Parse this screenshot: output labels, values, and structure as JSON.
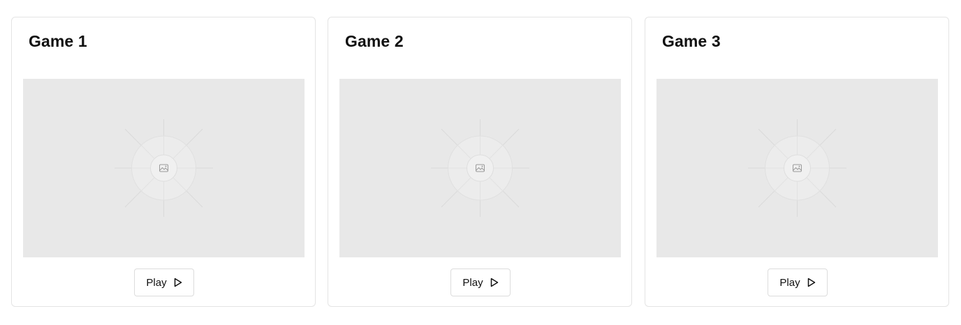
{
  "games": [
    {
      "title": "Game 1",
      "play_label": "Play",
      "image_icon": "image-icon",
      "play_icon": "play-icon"
    },
    {
      "title": "Game 2",
      "play_label": "Play",
      "image_icon": "image-icon",
      "play_icon": "play-icon"
    },
    {
      "title": "Game 3",
      "play_label": "Play",
      "image_icon": "image-icon",
      "play_icon": "play-icon"
    }
  ],
  "colors": {
    "card_border": "#e4e4e4",
    "thumbnail_bg": "#e8e8e8",
    "text": "#111111"
  }
}
